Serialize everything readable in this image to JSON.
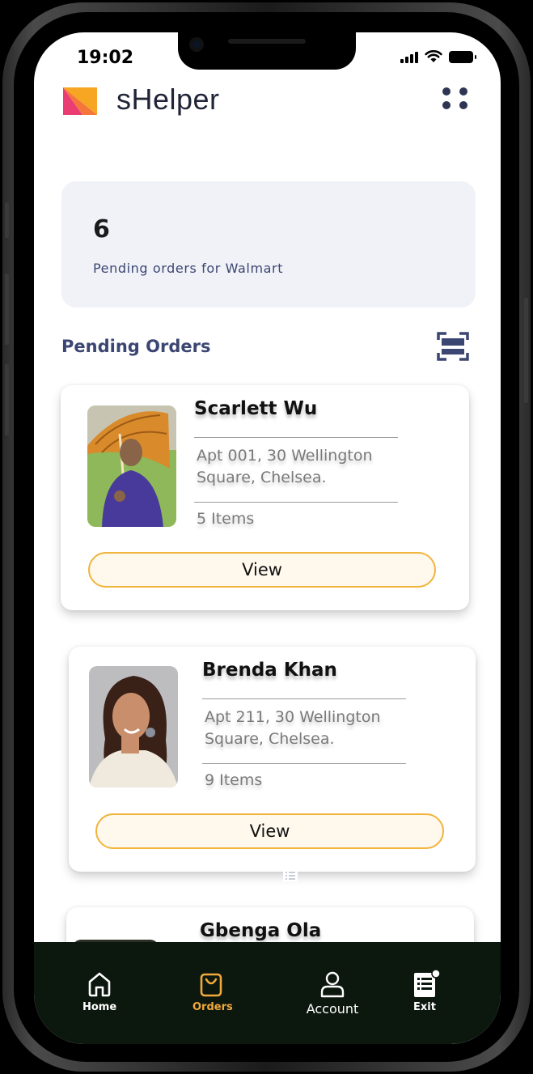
{
  "status_bar": {
    "time": "19:02"
  },
  "header": {
    "app_title": "sHelper"
  },
  "summary": {
    "count": "6",
    "label": "Pending orders for Walmart"
  },
  "section": {
    "title": "Pending Orders"
  },
  "orders": [
    {
      "name": "Scarlett Wu",
      "address": "Apt 001, 30 Wellington Square, Chelsea.",
      "items": "5 Items",
      "view_label": "View"
    },
    {
      "name": "Brenda Khan",
      "address": "Apt 211, 30 Wellington Square, Chelsea.",
      "items": "9 Items",
      "view_label": "View"
    },
    {
      "name": "Gbenga Ola"
    }
  ],
  "nav": [
    {
      "label": "Home",
      "icon": "home-icon"
    },
    {
      "label": "Orders",
      "icon": "shopping-bag-icon"
    },
    {
      "label": "Account",
      "icon": "user-icon"
    },
    {
      "label": "Exit",
      "icon": "exit-icon"
    }
  ],
  "colors": {
    "accent": "#f2a93b",
    "primary_text": "#3c4672",
    "nav_background": "#0c170e",
    "button_border": "#f1b43c",
    "card_background": "#f0f2f7"
  }
}
